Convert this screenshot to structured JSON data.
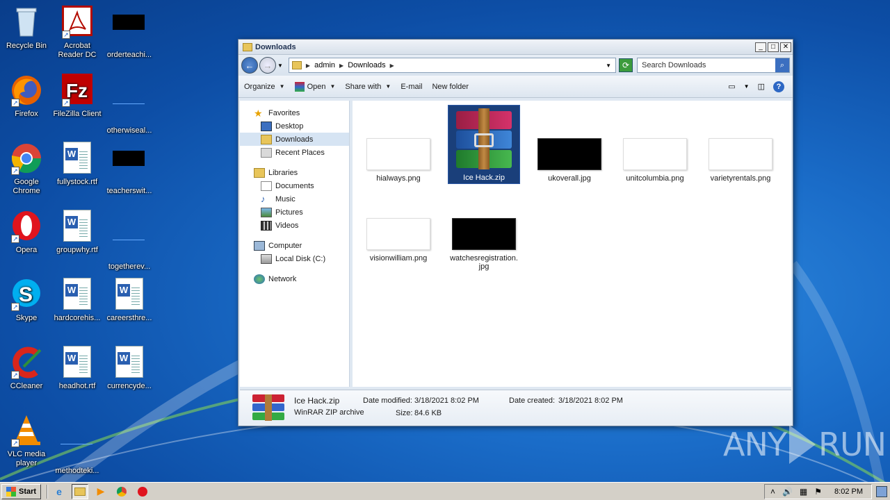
{
  "desktop": {
    "icons": [
      {
        "label": "Recycle Bin"
      },
      {
        "label": "Acrobat Reader DC"
      },
      {
        "label": "orderteachi..."
      },
      {
        "label": "Firefox"
      },
      {
        "label": "FileZilla Client"
      },
      {
        "label": "otherwiseal..."
      },
      {
        "label": "Google Chrome"
      },
      {
        "label": "fullystock.rtf"
      },
      {
        "label": "teacherswit..."
      },
      {
        "label": "Opera"
      },
      {
        "label": "groupwhy.rtf"
      },
      {
        "label": "togetherev..."
      },
      {
        "label": "Skype"
      },
      {
        "label": "hardcorehis..."
      },
      {
        "label": "careersthre..."
      },
      {
        "label": "CCleaner"
      },
      {
        "label": "headhot.rtf"
      },
      {
        "label": "currencyde..."
      },
      {
        "label": "VLC media player"
      },
      {
        "label": "methodteki..."
      }
    ]
  },
  "window": {
    "title": "Downloads",
    "address": {
      "crumbs": [
        "admin",
        "Downloads"
      ]
    },
    "search_placeholder": "Search Downloads",
    "toolbar": {
      "organize": "Organize",
      "open": "Open",
      "share_with": "Share with",
      "email": "E-mail",
      "new_folder": "New folder"
    },
    "nav": {
      "favorites": "Favorites",
      "desktop": "Desktop",
      "downloads": "Downloads",
      "recent_places": "Recent Places",
      "libraries": "Libraries",
      "documents": "Documents",
      "music": "Music",
      "pictures": "Pictures",
      "videos": "Videos",
      "computer": "Computer",
      "local_disk": "Local Disk (C:)",
      "network": "Network"
    },
    "files": [
      {
        "name": "hialways.png"
      },
      {
        "name": "Ice Hack.zip"
      },
      {
        "name": "ukoverall.jpg"
      },
      {
        "name": "unitcolumbia.png"
      },
      {
        "name": "varietyrentals.png"
      },
      {
        "name": "visionwilliam.png"
      },
      {
        "name": "watchesregistration.jpg"
      }
    ],
    "details": {
      "name": "Ice Hack.zip",
      "type": "WinRAR ZIP archive",
      "date_modified_label": "Date modified:",
      "date_modified": "3/18/2021 8:02 PM",
      "date_created_label": "Date created:",
      "date_created": "3/18/2021 8:02 PM",
      "size_label": "Size:",
      "size": "84.6 KB"
    }
  },
  "taskbar": {
    "start_label": "Start",
    "clock": "8:02 PM"
  },
  "watermark": {
    "left": "ANY",
    "right": "RUN"
  }
}
